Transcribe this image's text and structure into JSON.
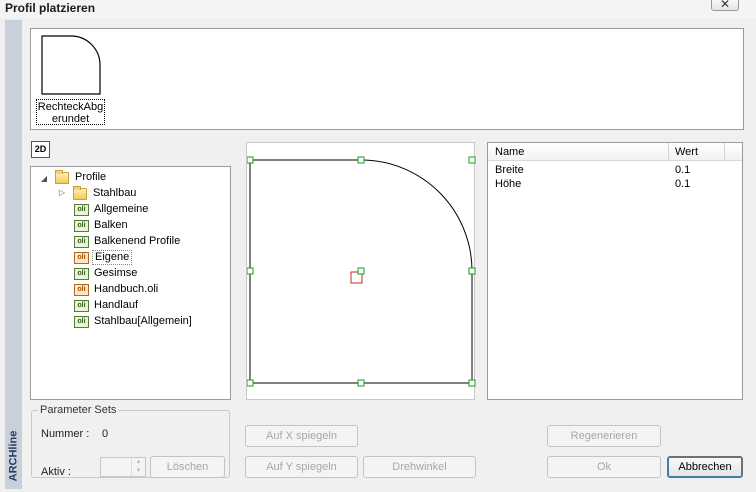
{
  "window": {
    "title": "Profil platzieren",
    "close_glyph": "✕"
  },
  "brand": {
    "label": "ARCHline"
  },
  "preview": {
    "thumbnail_label_line1": "RechteckAbg",
    "thumbnail_label_line2": "erundet"
  },
  "toolbar": {
    "view_2d_label": "2D"
  },
  "tree": {
    "root": {
      "label": "Profile",
      "icon": "folder-icon",
      "expander": "◢"
    },
    "children": [
      {
        "label": "Stahlbau",
        "icon": "folder-icon",
        "expander": "▷"
      },
      {
        "label": "Allgemeine",
        "icon": "oli-file-icon",
        "icon_text": "oli"
      },
      {
        "label": "Balken",
        "icon": "oli-file-icon",
        "icon_text": "oli"
      },
      {
        "label": "Balkenend Profile",
        "icon": "oli-file-icon",
        "icon_text": "oli"
      },
      {
        "label": "Eigene",
        "icon": "oli-file-icon",
        "icon_text": "oli",
        "selected": true
      },
      {
        "label": "Gesimse",
        "icon": "oli-file-icon",
        "icon_text": "oli"
      },
      {
        "label": "Handbuch.oli",
        "icon": "oli-file-icon",
        "icon_text": "oli"
      },
      {
        "label": "Handlauf",
        "icon": "oli-file-icon",
        "icon_text": "oli"
      },
      {
        "label": "Stahlbau[Allgemein]",
        "icon": "oli-file-icon",
        "icon_text": "oli"
      }
    ]
  },
  "properties": {
    "columns": [
      "Name",
      "Wert"
    ],
    "rows": [
      {
        "name": "Breite",
        "value": "0.1"
      },
      {
        "name": "Höhe",
        "value": "0.1"
      }
    ]
  },
  "parameter_sets": {
    "legend": "Parameter Sets",
    "number_label": "Nummer :",
    "number_value": "0",
    "active_label": "Aktiv :",
    "delete_label": "Löschen"
  },
  "buttons": {
    "mirror_x": "Auf X spiegeln",
    "mirror_y": "Auf Y spiegeln",
    "rotation": "Drehwinkel",
    "regenerate": "Regenerieren",
    "ok": "Ok",
    "cancel": "Abbrechen"
  },
  "colors": {
    "handle": "#1a9a1a",
    "anchor": "#c0282a",
    "sidebar": "#c8d0dc",
    "brand": "#2b3f60"
  }
}
